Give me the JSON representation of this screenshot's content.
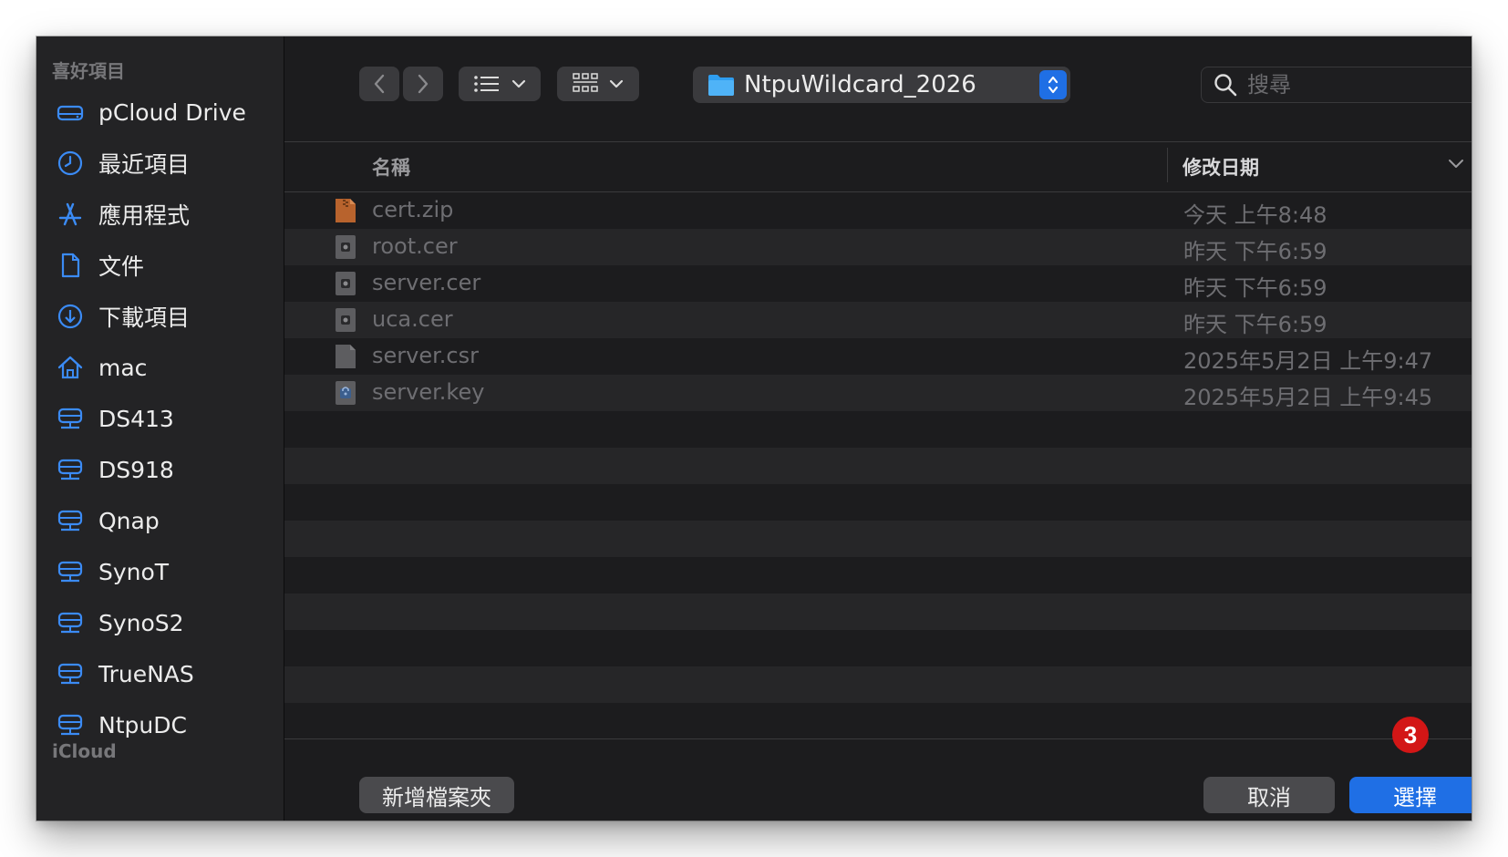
{
  "sidebar": {
    "favorites_heading": "喜好項目",
    "items": [
      {
        "label": "pCloud Drive",
        "icon": "drive-icon"
      },
      {
        "label": "最近項目",
        "icon": "clock-icon"
      },
      {
        "label": "應用程式",
        "icon": "apps-icon"
      },
      {
        "label": "文件",
        "icon": "document-icon"
      },
      {
        "label": "下載項目",
        "icon": "download-icon"
      },
      {
        "label": "mac",
        "icon": "home-icon"
      },
      {
        "label": "DS413",
        "icon": "server-icon"
      },
      {
        "label": "DS918",
        "icon": "server-icon"
      },
      {
        "label": "Qnap",
        "icon": "server-icon"
      },
      {
        "label": "SynoT",
        "icon": "server-icon"
      },
      {
        "label": "SynoS2",
        "icon": "server-icon"
      },
      {
        "label": "TrueNAS",
        "icon": "server-icon"
      },
      {
        "label": "NtpuDC",
        "icon": "server-icon"
      }
    ],
    "icloud_heading": "iCloud"
  },
  "toolbar": {
    "current_folder": "NtpuWildcard_2026",
    "search_placeholder": "搜尋"
  },
  "columns": {
    "name": "名稱",
    "date_modified": "修改日期"
  },
  "files": [
    {
      "name": "cert.zip",
      "date": "今天 上午8:48",
      "icon": "zip-icon"
    },
    {
      "name": "root.cer",
      "date": "昨天 下午6:59",
      "icon": "certificate-icon"
    },
    {
      "name": "server.cer",
      "date": "昨天 下午6:59",
      "icon": "certificate-icon"
    },
    {
      "name": "uca.cer",
      "date": "昨天 下午6:59",
      "icon": "certificate-icon"
    },
    {
      "name": "server.csr",
      "date": "2025年5月2日 上午9:47",
      "icon": "blank-file-icon"
    },
    {
      "name": "server.key",
      "date": "2025年5月2日 上午9:45",
      "icon": "key-file-icon"
    }
  ],
  "footer": {
    "new_folder_label": "新增檔案夾",
    "cancel_label": "取消",
    "choose_label": "選擇",
    "step_badge": "3"
  },
  "colors": {
    "accent": "#1f6fe5",
    "badge": "#d31616",
    "sidebar_icon": "#3b8bf5"
  }
}
